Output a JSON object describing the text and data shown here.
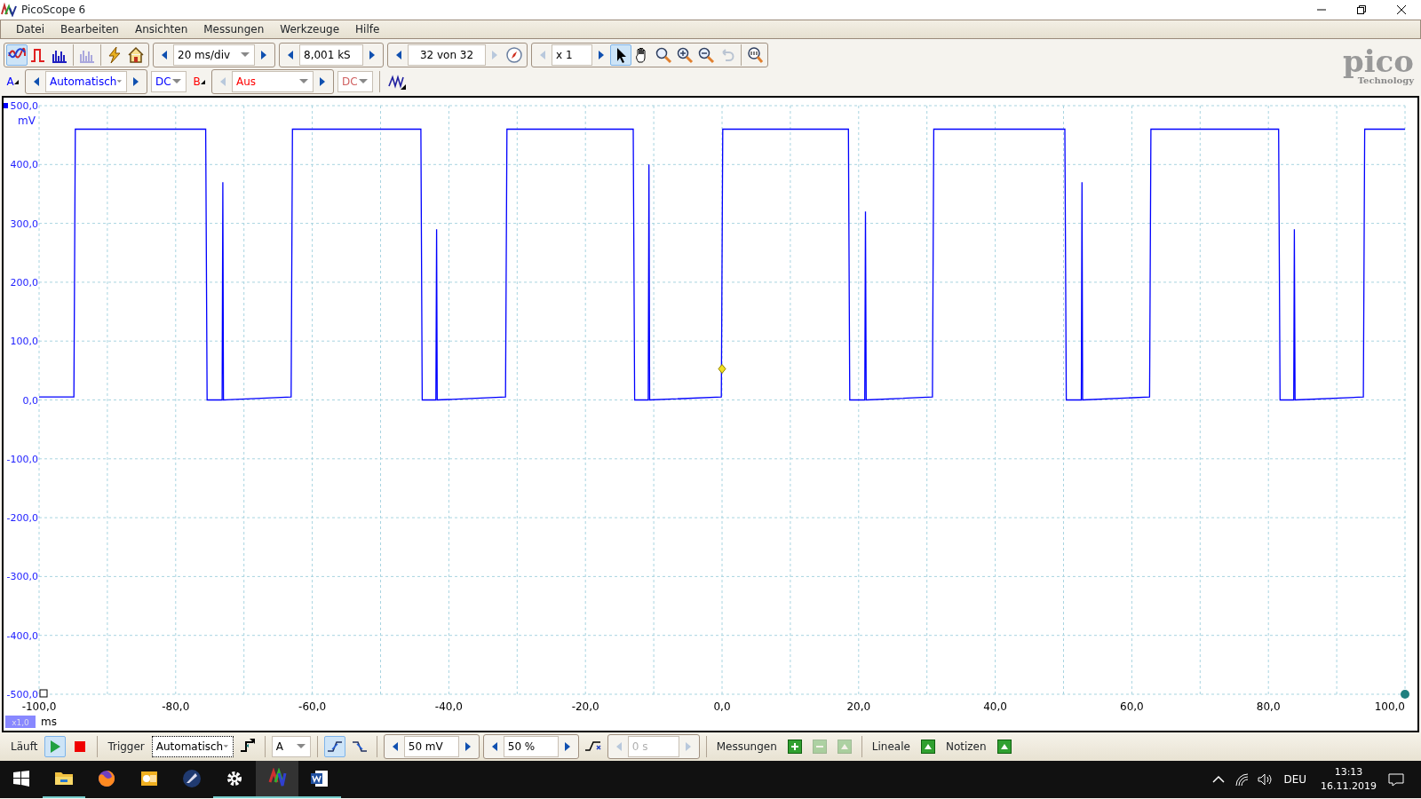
{
  "window": {
    "title": "PicoScope 6"
  },
  "menu": [
    "Datei",
    "Bearbeiten",
    "Ansichten",
    "Messungen",
    "Werkzeuge",
    "Hilfe"
  ],
  "toolbar": {
    "modes": [
      {
        "kind": "scope",
        "selected": true,
        "disabled": false
      },
      {
        "kind": "persist",
        "selected": false,
        "disabled": false
      },
      {
        "kind": "spectrum",
        "selected": false,
        "disabled": false
      },
      {
        "kind": "spectrum",
        "selected": false,
        "disabled": true
      },
      {
        "kind": "lightning",
        "selected": false,
        "disabled": false
      },
      {
        "kind": "home",
        "selected": false,
        "disabled": false
      }
    ],
    "timebase": "20 ms/div",
    "samples": "8,001 kS",
    "buffer": "32 von 32",
    "zoom": "x 1",
    "tools": [
      {
        "kind": "pointer",
        "selected": true,
        "disabled": false
      },
      {
        "kind": "hand",
        "selected": false,
        "disabled": false
      },
      {
        "kind": "zoomfit",
        "selected": false,
        "disabled": false
      },
      {
        "kind": "zoomin",
        "selected": false,
        "disabled": false
      },
      {
        "kind": "zoomout",
        "selected": false,
        "disabled": false
      },
      {
        "kind": "undo",
        "selected": false,
        "disabled": true
      },
      {
        "kind": "zoom100",
        "selected": false,
        "disabled": false
      }
    ]
  },
  "logo": {
    "name": "pico",
    "subtitle": "Technology"
  },
  "channels": [
    {
      "label": "A",
      "range": "Automatisch",
      "coupling": "DC",
      "enabled": true,
      "color": "#0000ff"
    },
    {
      "label": "B",
      "range": "Aus",
      "coupling": "DC",
      "enabled": false,
      "color": "#ff0000"
    }
  ],
  "chart_data": {
    "type": "line",
    "xlabel": "ms",
    "ylabel": "mV",
    "xlim": [
      -100,
      100
    ],
    "ylim": [
      -500,
      500
    ],
    "xticks": [
      {
        "value": -100,
        "label": "-100,0"
      },
      {
        "value": -80,
        "label": "-80,0"
      },
      {
        "value": -60,
        "label": "-60,0"
      },
      {
        "value": -40,
        "label": "-40,0"
      },
      {
        "value": -20,
        "label": "-20,0"
      },
      {
        "value": 0,
        "label": "0,0"
      },
      {
        "value": 20,
        "label": "20,0"
      },
      {
        "value": 40,
        "label": "40,0"
      },
      {
        "value": 60,
        "label": "60,0"
      },
      {
        "value": 80,
        "label": "80,0"
      },
      {
        "value": 100,
        "label": "100,0"
      }
    ],
    "yticks": [
      {
        "value": 500,
        "label": "500,0"
      },
      {
        "value": 400,
        "label": "400,0"
      },
      {
        "value": 300,
        "label": "300,0"
      },
      {
        "value": 200,
        "label": "200,0"
      },
      {
        "value": 100,
        "label": "100,0"
      },
      {
        "value": 0,
        "label": "0,0"
      },
      {
        "value": -100,
        "label": "-100,0"
      },
      {
        "value": -200,
        "label": "-200,0"
      },
      {
        "value": -300,
        "label": "-300,0"
      },
      {
        "value": -400,
        "label": "-400,0"
      },
      {
        "value": -500,
        "label": "-500,0"
      }
    ],
    "x": [
      -100,
      -94.9,
      -94.7,
      -75.6,
      -75.4,
      -73.2,
      -73.1,
      -73.0,
      -63.1,
      -62.9,
      -44.1,
      -43.9,
      -41.9,
      -41.8,
      -41.7,
      -31.7,
      -31.5,
      -13.0,
      -12.8,
      -10.8,
      -10.7,
      -10.6,
      -0.1,
      0.1,
      18.5,
      18.7,
      20.9,
      21.0,
      21.1,
      30.8,
      31.0,
      50.2,
      50.4,
      52.6,
      52.7,
      52.8,
      62.6,
      62.8,
      81.5,
      81.7,
      83.7,
      83.8,
      83.9,
      93.9,
      94.1,
      100
    ],
    "grid": true,
    "series": [
      {
        "color": "#0000ff",
        "values": [
          5,
          5,
          460,
          460,
          0,
          0,
          370,
          0,
          5,
          460,
          460,
          0,
          0,
          290,
          0,
          5,
          460,
          460,
          0,
          0,
          400,
          0,
          5,
          460,
          460,
          0,
          0,
          320,
          0,
          5,
          460,
          460,
          0,
          0,
          370,
          0,
          5,
          460,
          460,
          0,
          0,
          290,
          0,
          5,
          460,
          460
        ]
      }
    ]
  },
  "scale_badge": "x1,0",
  "bottom": {
    "run_label": "Läuft",
    "running": true,
    "trigger_label": "Trigger",
    "trigger_mode": "Automatisch",
    "source": "A",
    "edges": [
      {
        "kind": "rising",
        "selected": true
      },
      {
        "kind": "falling",
        "selected": false
      }
    ],
    "threshold": "50 mV",
    "pretrigger": "50 %",
    "delay": "0 s",
    "measurements_label": "Messungen",
    "rulers_label": "Lineale",
    "notes_label": "Notizen"
  },
  "taskbar": {
    "apps": [
      {
        "kind": "explorer",
        "active": false,
        "open": true
      },
      {
        "kind": "firefox",
        "active": false,
        "open": false
      },
      {
        "kind": "outlook",
        "active": false,
        "open": false
      },
      {
        "kind": "pen",
        "active": false,
        "open": false
      },
      {
        "kind": "settings",
        "active": false,
        "open": true
      },
      {
        "kind": "scope",
        "active": true,
        "open": true
      },
      {
        "kind": "word",
        "active": false,
        "open": true
      }
    ],
    "language": "DEU",
    "time": "13:13",
    "date": "16.11.2019"
  }
}
